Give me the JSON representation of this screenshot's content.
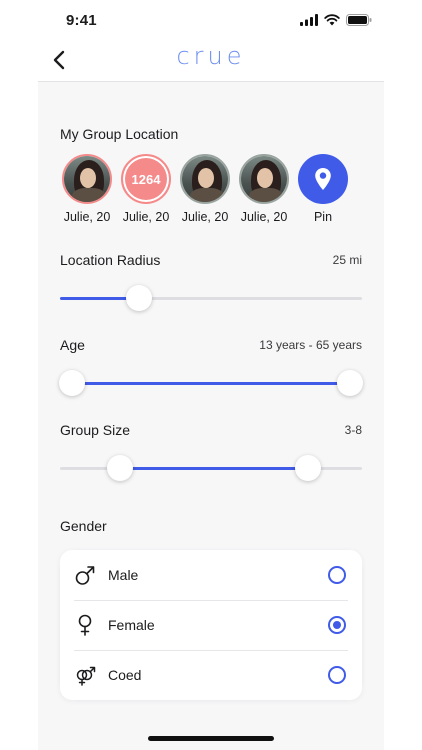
{
  "status_bar": {
    "time": "9:41"
  },
  "header": {
    "logo": "crue"
  },
  "group_location": {
    "title": "My Group Location",
    "members": [
      {
        "label": "Julie, 20",
        "type": "photo",
        "ring": "red"
      },
      {
        "label": "Julie, 20",
        "type": "count",
        "count": "1264"
      },
      {
        "label": "Julie, 20",
        "type": "photo",
        "ring": "gray"
      },
      {
        "label": "Julie, 20",
        "type": "photo",
        "ring": "gray"
      },
      {
        "label": "Pin",
        "type": "pin-icon"
      }
    ]
  },
  "location_radius": {
    "title": "Location Radius",
    "value": "25 mi",
    "fraction": 0.26
  },
  "age": {
    "title": "Age",
    "value": "13 years - 65 years",
    "low_fraction": 0.04,
    "high_fraction": 0.96
  },
  "group_size": {
    "title": "Group Size",
    "value": "3-8",
    "low_fraction": 0.2,
    "high_fraction": 0.82
  },
  "gender": {
    "title": "Gender",
    "options": [
      {
        "label": "Male",
        "icon": "male-icon",
        "selected": false
      },
      {
        "label": "Female",
        "icon": "female-icon",
        "selected": true
      },
      {
        "label": "Coed",
        "icon": "coed-icon",
        "selected": false
      }
    ]
  },
  "colors": {
    "accent": "#3f5be8",
    "logo": "#6f8ff0",
    "count_badge": "#f58a8a",
    "background": "#f7f7f8"
  }
}
